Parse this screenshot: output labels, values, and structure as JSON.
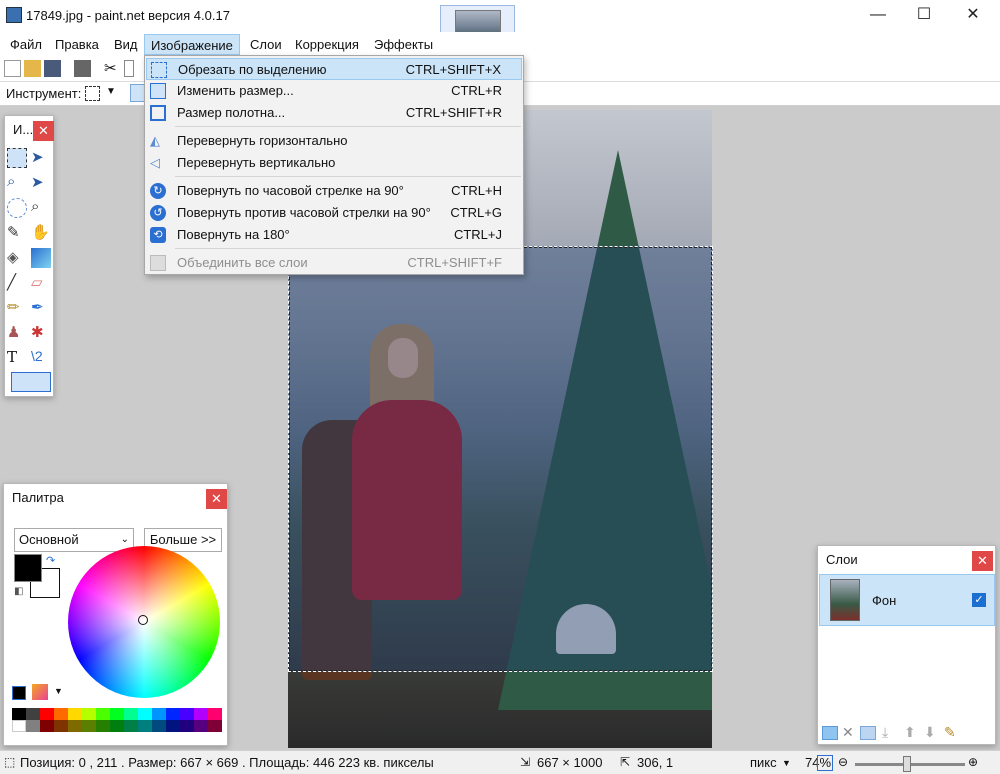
{
  "window": {
    "title": "17849.jpg - paint.net версия 4.0.17",
    "minimize": "—",
    "maximize": "☐",
    "close": "✕"
  },
  "menubar": {
    "items": [
      "Файл",
      "Правка",
      "Вид",
      "Изображение",
      "Слои",
      "Коррекция",
      "Эффекты"
    ],
    "open": "Изображение"
  },
  "toolbar": {
    "tool_label": "Инструмент:"
  },
  "image_menu": {
    "items": [
      {
        "label": "Обрезать по выделению",
        "shortcut": "CTRL+SHIFT+X",
        "icon": "crop-icon"
      },
      {
        "label": "Изменить размер...",
        "shortcut": "CTRL+R",
        "icon": "resize-icon"
      },
      {
        "label": "Размер полотна...",
        "shortcut": "CTRL+SHIFT+R",
        "icon": "canvas-size-icon"
      },
      {
        "label": "Перевернуть горизонтально",
        "shortcut": "",
        "icon": "flip-horizontal-icon"
      },
      {
        "label": "Перевернуть вертикально",
        "shortcut": "",
        "icon": "flip-vertical-icon"
      },
      {
        "label": "Повернуть по часовой стрелке на 90°",
        "shortcut": "CTRL+H",
        "icon": "rotate-cw-icon"
      },
      {
        "label": "Повернуть против часовой стрелки на 90°",
        "shortcut": "CTRL+G",
        "icon": "rotate-ccw-icon"
      },
      {
        "label": "Повернуть на 180°",
        "shortcut": "CTRL+J",
        "icon": "rotate-180-icon"
      },
      {
        "label": "Объединить все слои",
        "shortcut": "CTRL+SHIFT+F",
        "icon": "flatten-icon"
      }
    ]
  },
  "tools_window": {
    "title": "И..."
  },
  "palette_window": {
    "title": "Палитра",
    "mode": "Основной",
    "more_button": "Больше >>",
    "primary_color": "#000000",
    "secondary_color": "#ffffff"
  },
  "layers_window": {
    "title": "Слои",
    "layers": [
      {
        "name": "Фон",
        "visible": true
      }
    ]
  },
  "statusbar": {
    "info": "Позиция: 0 , 211 . Размер: 667  × 669 . Площадь: 446 223 кв. пикселы",
    "image_size": "667 × 1000",
    "cursor": "306, 1",
    "units": "пикс",
    "zoom": "74%"
  },
  "colors": {
    "accent": "#cce4f7",
    "close_red": "#e04848"
  }
}
